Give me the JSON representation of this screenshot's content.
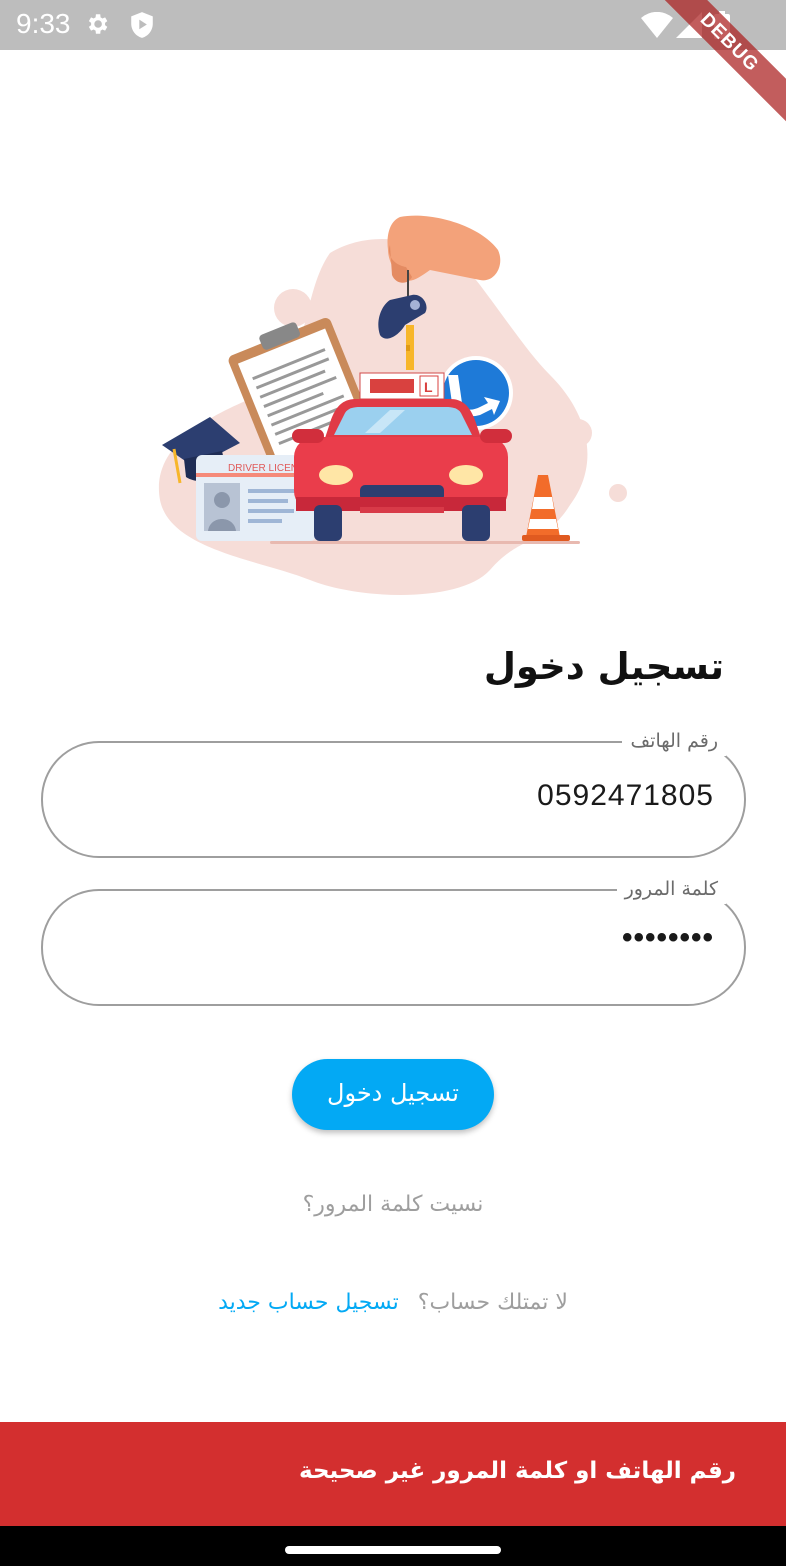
{
  "status_bar": {
    "time": "9:33",
    "icons": [
      "settings-icon",
      "shield-icon",
      "wifi-icon",
      "cellular-icon",
      "battery-icon"
    ]
  },
  "debug_banner": "DEBUG",
  "illustration": {
    "license_text": "DRIVER LICENSE",
    "l_plate": "L"
  },
  "login": {
    "title": "تسجيل دخول",
    "phone_label": "رقم الهاتف",
    "phone_value": "0592471805",
    "password_label": "كلمة المرور",
    "password_value": "••••••••",
    "button_label": "تسجيل دخول",
    "forgot_password": "نسيت كلمة المرور؟",
    "no_account_prompt": "لا تمتلك حساب؟",
    "register_link": "تسجيل حساب جديد"
  },
  "snackbar": {
    "message": "رقم الهاتف او كلمة المرور غير صحيحة"
  },
  "colors": {
    "accent": "#03a9f4",
    "error": "#d32f2f",
    "status_bar": "#bdbdbd"
  }
}
